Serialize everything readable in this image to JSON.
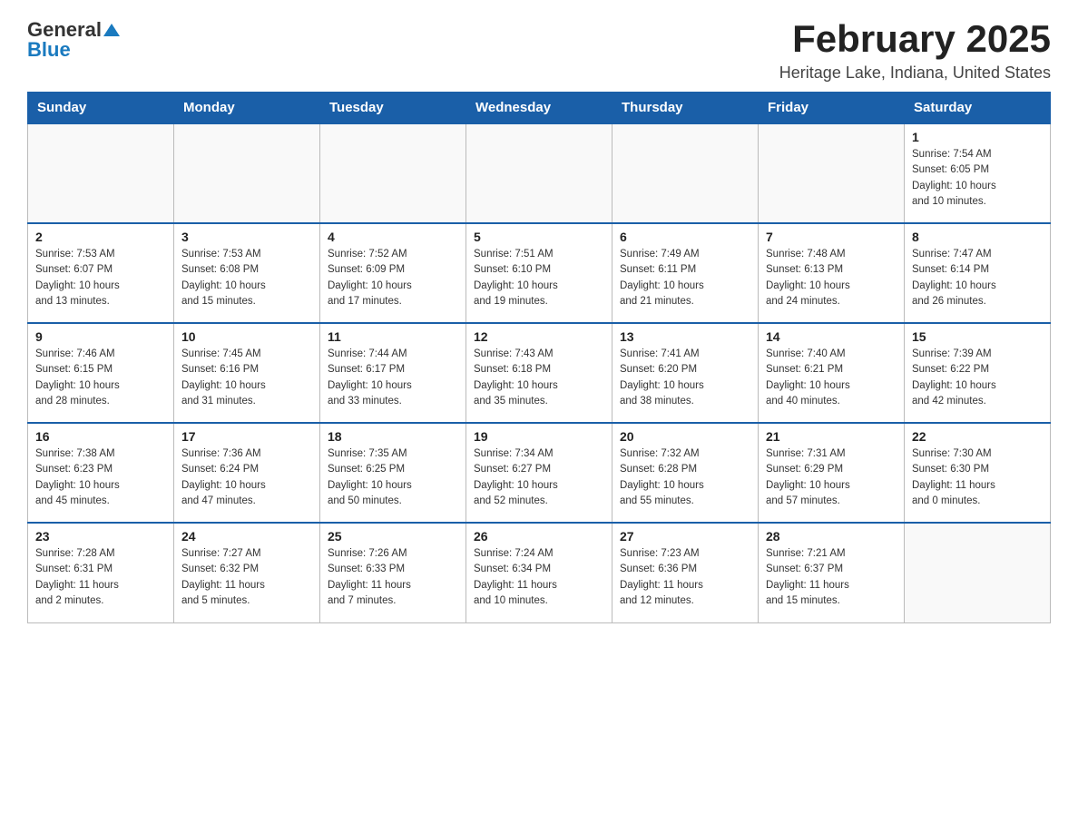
{
  "header": {
    "logo_general": "General",
    "logo_blue": "Blue",
    "title": "February 2025",
    "subtitle": "Heritage Lake, Indiana, United States"
  },
  "weekdays": [
    "Sunday",
    "Monday",
    "Tuesday",
    "Wednesday",
    "Thursday",
    "Friday",
    "Saturday"
  ],
  "weeks": [
    [
      {
        "day": "",
        "info": ""
      },
      {
        "day": "",
        "info": ""
      },
      {
        "day": "",
        "info": ""
      },
      {
        "day": "",
        "info": ""
      },
      {
        "day": "",
        "info": ""
      },
      {
        "day": "",
        "info": ""
      },
      {
        "day": "1",
        "info": "Sunrise: 7:54 AM\nSunset: 6:05 PM\nDaylight: 10 hours\nand 10 minutes."
      }
    ],
    [
      {
        "day": "2",
        "info": "Sunrise: 7:53 AM\nSunset: 6:07 PM\nDaylight: 10 hours\nand 13 minutes."
      },
      {
        "day": "3",
        "info": "Sunrise: 7:53 AM\nSunset: 6:08 PM\nDaylight: 10 hours\nand 15 minutes."
      },
      {
        "day": "4",
        "info": "Sunrise: 7:52 AM\nSunset: 6:09 PM\nDaylight: 10 hours\nand 17 minutes."
      },
      {
        "day": "5",
        "info": "Sunrise: 7:51 AM\nSunset: 6:10 PM\nDaylight: 10 hours\nand 19 minutes."
      },
      {
        "day": "6",
        "info": "Sunrise: 7:49 AM\nSunset: 6:11 PM\nDaylight: 10 hours\nand 21 minutes."
      },
      {
        "day": "7",
        "info": "Sunrise: 7:48 AM\nSunset: 6:13 PM\nDaylight: 10 hours\nand 24 minutes."
      },
      {
        "day": "8",
        "info": "Sunrise: 7:47 AM\nSunset: 6:14 PM\nDaylight: 10 hours\nand 26 minutes."
      }
    ],
    [
      {
        "day": "9",
        "info": "Sunrise: 7:46 AM\nSunset: 6:15 PM\nDaylight: 10 hours\nand 28 minutes."
      },
      {
        "day": "10",
        "info": "Sunrise: 7:45 AM\nSunset: 6:16 PM\nDaylight: 10 hours\nand 31 minutes."
      },
      {
        "day": "11",
        "info": "Sunrise: 7:44 AM\nSunset: 6:17 PM\nDaylight: 10 hours\nand 33 minutes."
      },
      {
        "day": "12",
        "info": "Sunrise: 7:43 AM\nSunset: 6:18 PM\nDaylight: 10 hours\nand 35 minutes."
      },
      {
        "day": "13",
        "info": "Sunrise: 7:41 AM\nSunset: 6:20 PM\nDaylight: 10 hours\nand 38 minutes."
      },
      {
        "day": "14",
        "info": "Sunrise: 7:40 AM\nSunset: 6:21 PM\nDaylight: 10 hours\nand 40 minutes."
      },
      {
        "day": "15",
        "info": "Sunrise: 7:39 AM\nSunset: 6:22 PM\nDaylight: 10 hours\nand 42 minutes."
      }
    ],
    [
      {
        "day": "16",
        "info": "Sunrise: 7:38 AM\nSunset: 6:23 PM\nDaylight: 10 hours\nand 45 minutes."
      },
      {
        "day": "17",
        "info": "Sunrise: 7:36 AM\nSunset: 6:24 PM\nDaylight: 10 hours\nand 47 minutes."
      },
      {
        "day": "18",
        "info": "Sunrise: 7:35 AM\nSunset: 6:25 PM\nDaylight: 10 hours\nand 50 minutes."
      },
      {
        "day": "19",
        "info": "Sunrise: 7:34 AM\nSunset: 6:27 PM\nDaylight: 10 hours\nand 52 minutes."
      },
      {
        "day": "20",
        "info": "Sunrise: 7:32 AM\nSunset: 6:28 PM\nDaylight: 10 hours\nand 55 minutes."
      },
      {
        "day": "21",
        "info": "Sunrise: 7:31 AM\nSunset: 6:29 PM\nDaylight: 10 hours\nand 57 minutes."
      },
      {
        "day": "22",
        "info": "Sunrise: 7:30 AM\nSunset: 6:30 PM\nDaylight: 11 hours\nand 0 minutes."
      }
    ],
    [
      {
        "day": "23",
        "info": "Sunrise: 7:28 AM\nSunset: 6:31 PM\nDaylight: 11 hours\nand 2 minutes."
      },
      {
        "day": "24",
        "info": "Sunrise: 7:27 AM\nSunset: 6:32 PM\nDaylight: 11 hours\nand 5 minutes."
      },
      {
        "day": "25",
        "info": "Sunrise: 7:26 AM\nSunset: 6:33 PM\nDaylight: 11 hours\nand 7 minutes."
      },
      {
        "day": "26",
        "info": "Sunrise: 7:24 AM\nSunset: 6:34 PM\nDaylight: 11 hours\nand 10 minutes."
      },
      {
        "day": "27",
        "info": "Sunrise: 7:23 AM\nSunset: 6:36 PM\nDaylight: 11 hours\nand 12 minutes."
      },
      {
        "day": "28",
        "info": "Sunrise: 7:21 AM\nSunset: 6:37 PM\nDaylight: 11 hours\nand 15 minutes."
      },
      {
        "day": "",
        "info": ""
      }
    ]
  ]
}
